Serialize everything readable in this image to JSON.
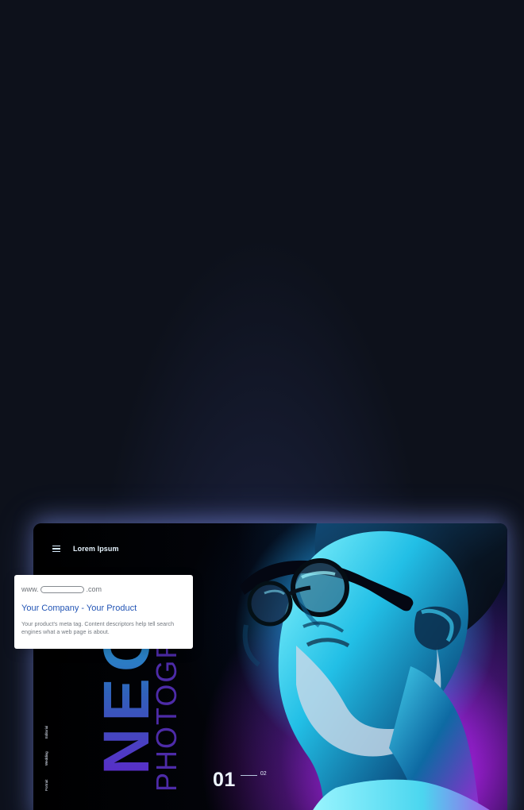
{
  "app": {
    "brand": "Lorem Ipsum"
  },
  "hero": {
    "title_main": "NEO",
    "title_secondary": "PHOTOGRA",
    "slide_current": "01",
    "slide_next": "02",
    "side_links": [
      "Portrait",
      "Wedding",
      "Editorial"
    ]
  },
  "search_preview": {
    "url_prefix": "www.",
    "url_suffix": ".com",
    "title": "Your Company - Your Product",
    "description": "Your product's meta tag. Content descriptors help tell search engines what a web page is about."
  },
  "icons": {
    "menu": "hamburger-icon"
  },
  "colors": {
    "background": "#0d111b",
    "glow": "#8ea0ff",
    "cyan": "#3ef2ff",
    "magenta": "#9b1ed2",
    "link": "#2355b5"
  }
}
